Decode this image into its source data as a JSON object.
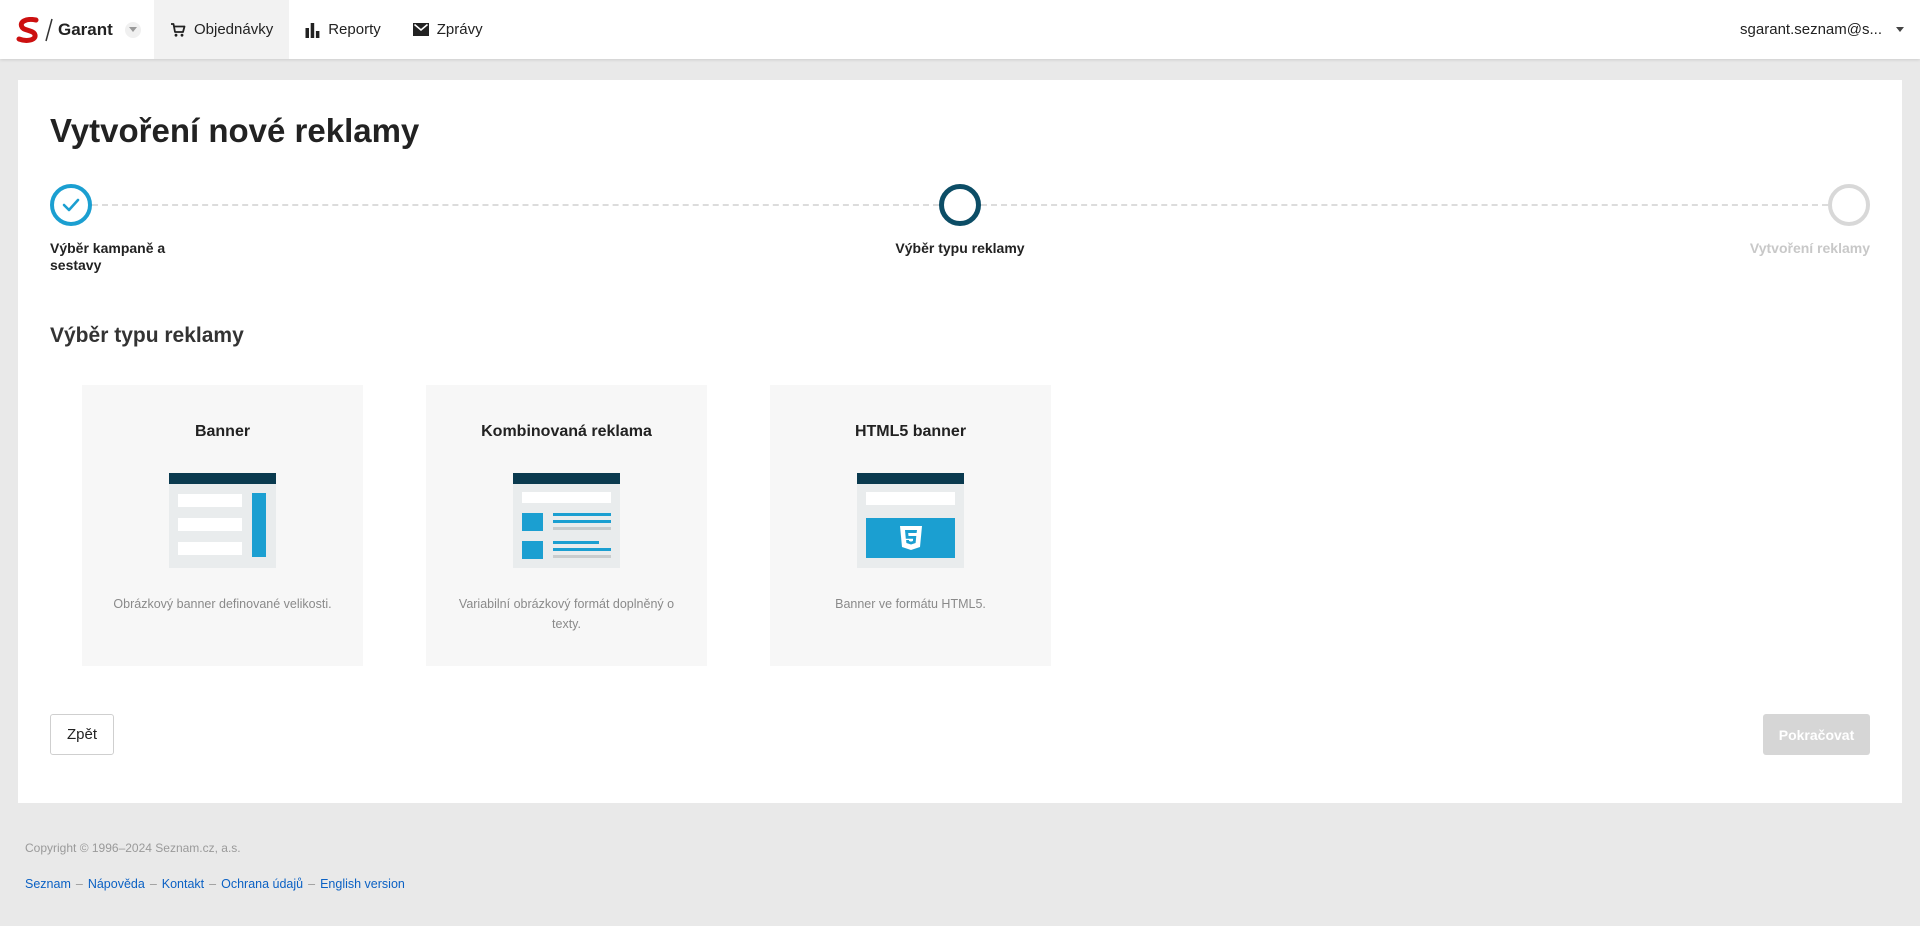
{
  "app": {
    "name": "Garant"
  },
  "nav": [
    {
      "label": "Objednávky",
      "icon": "cart-icon",
      "active": true
    },
    {
      "label": "Reporty",
      "icon": "bar-chart-icon",
      "active": false
    },
    {
      "label": "Zprávy",
      "icon": "envelope-icon",
      "active": false
    }
  ],
  "user": {
    "email": "sgarant.seznam@s..."
  },
  "page": {
    "title": "Vytvoření nové reklamy"
  },
  "steps": [
    {
      "label_line1": "Výběr kampaně a",
      "label_line2": "sestavy",
      "state": "done"
    },
    {
      "label_line1": "Výběr typu reklamy",
      "label_line2": "",
      "state": "current"
    },
    {
      "label_line1": "Vytvoření reklamy",
      "label_line2": "",
      "state": "todo"
    }
  ],
  "section": {
    "title": "Výběr typu reklamy"
  },
  "ad_types": [
    {
      "title": "Banner",
      "description": "Obrázkový banner definované velikosti."
    },
    {
      "title": "Kombinovaná reklama",
      "description": "Variabilní obrázkový formát doplněný o texty."
    },
    {
      "title": "HTML5 banner",
      "description": "Banner ve formátu HTML5."
    }
  ],
  "buttons": {
    "back": "Zpět",
    "next": "Pokračovat"
  },
  "footer": {
    "copyright": "Copyright © 1996–2024 Seznam.cz, a.s.",
    "links": [
      "Seznam",
      "Nápověda",
      "Kontakt",
      "Ochrana údajů",
      "English version"
    ],
    "separator": "–"
  },
  "colors": {
    "accent": "#1b9fd1",
    "dark_accent": "#0c4d66",
    "icon_dark": "#0a3a4f",
    "link": "#0b61c4",
    "disabled": "#d6d6d6"
  }
}
